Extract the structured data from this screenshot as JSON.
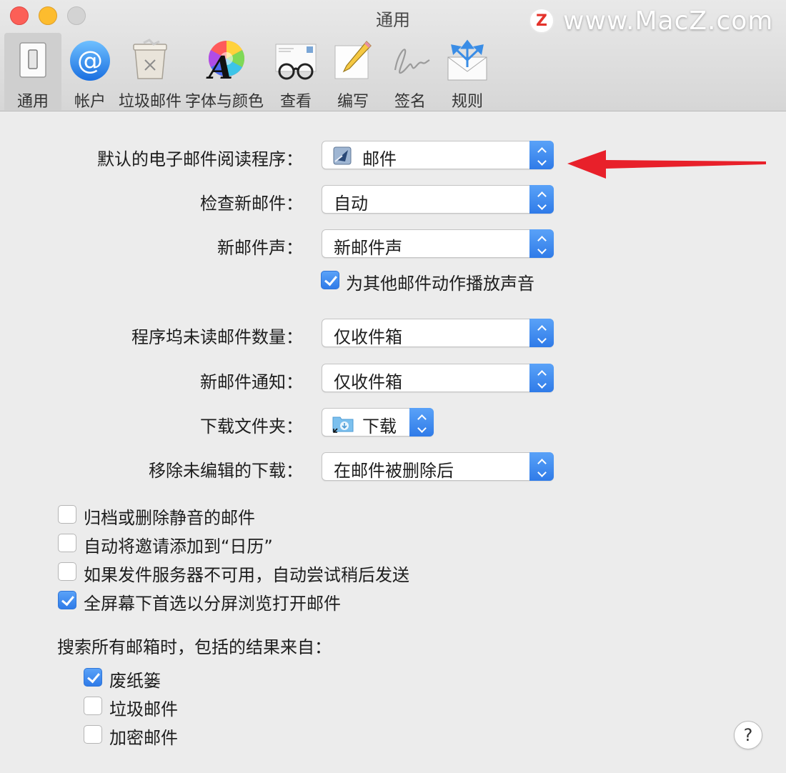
{
  "window": {
    "title": "通用",
    "watermark_text": "www.MacZ.com",
    "watermark_logo": "Z"
  },
  "toolbar": {
    "items": [
      {
        "label": "通用",
        "icon": "switch-icon",
        "selected": true
      },
      {
        "label": "帐户",
        "icon": "at-sign-icon",
        "selected": false
      },
      {
        "label": "垃圾邮件",
        "icon": "trash-bin-icon",
        "selected": false
      },
      {
        "label": "字体与颜色",
        "icon": "font-color-wheel-icon",
        "selected": false
      },
      {
        "label": "查看",
        "icon": "glasses-icon",
        "selected": false
      },
      {
        "label": "编写",
        "icon": "pencil-paper-icon",
        "selected": false
      },
      {
        "label": "签名",
        "icon": "signature-icon",
        "selected": false
      },
      {
        "label": "规则",
        "icon": "envelope-arrows-icon",
        "selected": false
      }
    ]
  },
  "settings": {
    "default_reader": {
      "label": "默认的电子邮件阅读程序：",
      "value": "邮件",
      "icon": "mail-app-icon"
    },
    "check_new_mail": {
      "label": "检查新邮件：",
      "value": "自动"
    },
    "new_mail_sound": {
      "label": "新邮件声：",
      "value": "新邮件声"
    },
    "play_sounds": {
      "label": "为其他邮件动作播放声音",
      "checked": true
    },
    "dock_unread_count": {
      "label": "程序坞未读邮件数量：",
      "value": "仅收件箱"
    },
    "new_mail_notifications": {
      "label": "新邮件通知：",
      "value": "仅收件箱"
    },
    "downloads_folder": {
      "label": "下载文件夹：",
      "value": "下载",
      "icon": "downloads-folder-icon"
    },
    "remove_unedited_downloads": {
      "label": "移除未编辑的下载：",
      "value": "在邮件被删除后"
    }
  },
  "options": [
    {
      "label": "归档或删除静音的邮件",
      "checked": false
    },
    {
      "label": "自动将邀请添加到“日历”",
      "checked": false
    },
    {
      "label": "如果发件服务器不可用，自动尝试稍后发送",
      "checked": false
    },
    {
      "label": "全屏幕下首选以分屏浏览打开邮件",
      "checked": true
    }
  ],
  "search": {
    "title": "搜索所有邮箱时，包括的结果来自：",
    "items": [
      {
        "label": "废纸篓",
        "checked": true
      },
      {
        "label": "垃圾邮件",
        "checked": false
      },
      {
        "label": "加密邮件",
        "checked": false
      }
    ]
  },
  "help": {
    "label": "?"
  },
  "colors": {
    "accent": "#2f7be8",
    "annotation_arrow": "#e8202a"
  }
}
